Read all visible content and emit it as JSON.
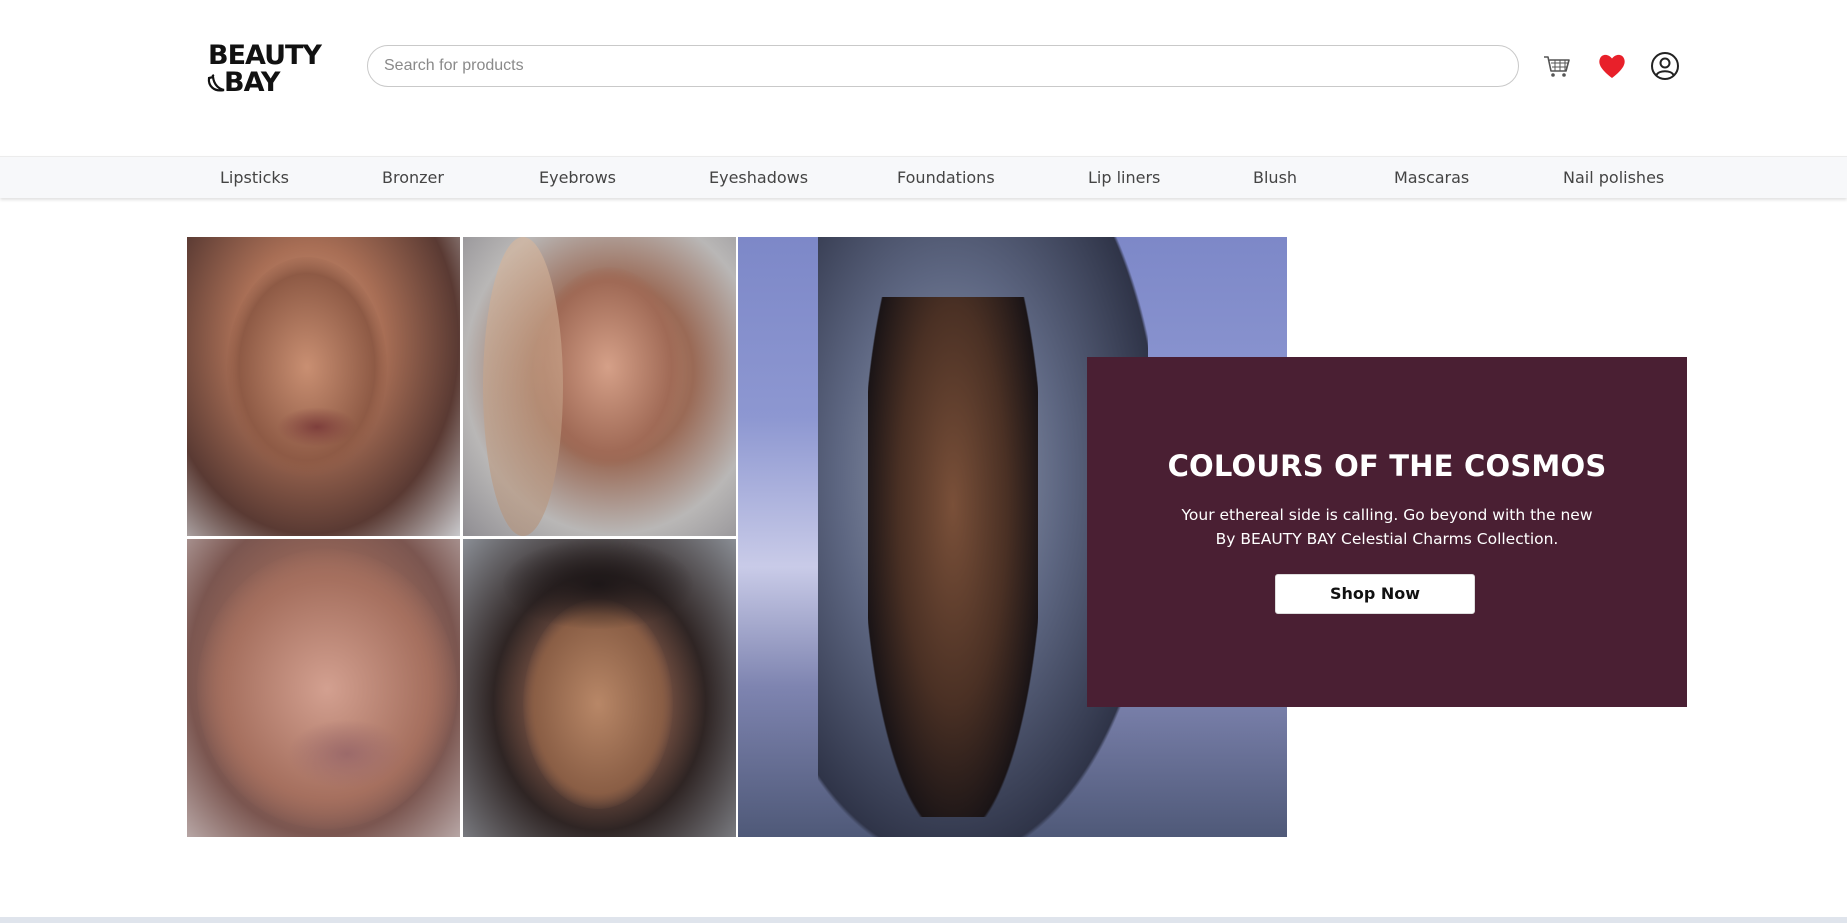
{
  "brand": {
    "line1": "BEAUTY",
    "line2": "BAY"
  },
  "search": {
    "placeholder": "Search for products"
  },
  "header_icons": [
    "cart-icon",
    "heart-icon",
    "user-icon"
  ],
  "nav": {
    "items": [
      "Lipsticks",
      "Bronzer",
      "Eyebrows",
      "Eyeshadows",
      "Foundations",
      "Lip liners",
      "Blush",
      "Mascaras",
      "Nail polishes"
    ]
  },
  "hero": {
    "title": "COLOURS OF THE COSMOS",
    "description": "Your ethereal side is calling. Go beyond with the new By BEAUTY BAY Celestial Charms Collection.",
    "cta_label": "Shop Now"
  },
  "colors": {
    "promo_bg": "#4a1f33",
    "heart": "#e8202a",
    "nav_bg": "#f7f8fa"
  }
}
